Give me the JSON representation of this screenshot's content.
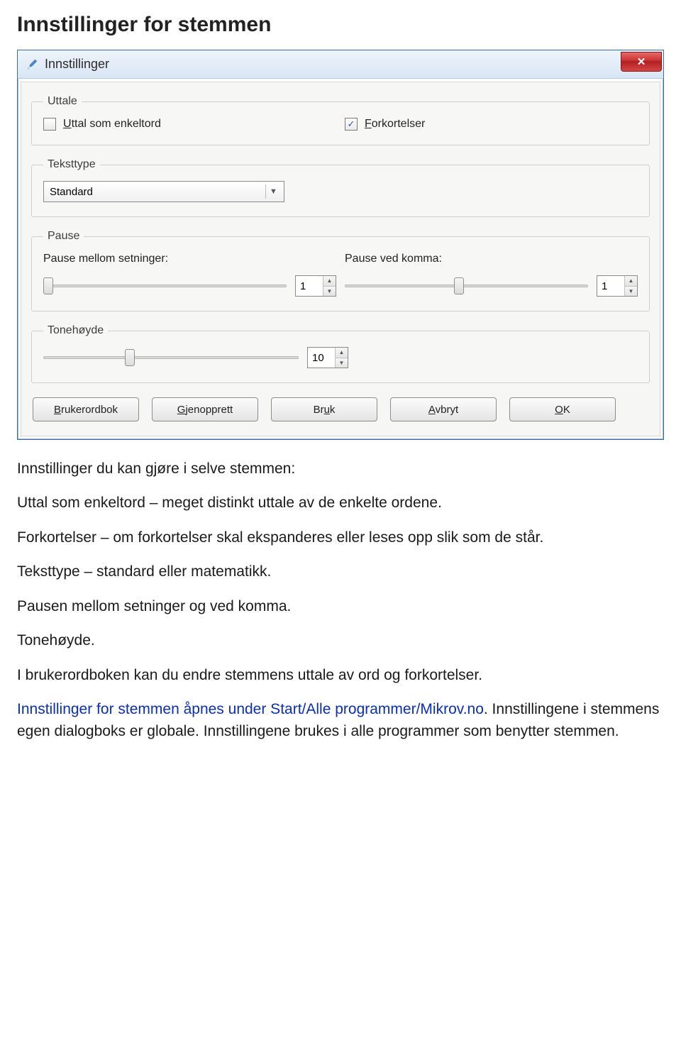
{
  "page_heading": "Innstillinger for stemmen",
  "window": {
    "title": "Innstillinger",
    "close_glyph": "✕"
  },
  "uttale": {
    "legend": "Uttale",
    "checkbox1": {
      "label_pre": "",
      "mn": "U",
      "label_post": "ttal som enkeltord",
      "checked": false
    },
    "checkbox2": {
      "label_pre": "",
      "mn": "F",
      "label_post": "orkortelser",
      "checked": true
    },
    "check_glyph": "✓"
  },
  "teksttype": {
    "legend": "Teksttype",
    "value": "Standard"
  },
  "pause": {
    "legend": "Pause",
    "left_label": "Pause mellom setninger:",
    "left_value": "1",
    "right_label": "Pause ved komma:",
    "right_value": "1"
  },
  "tonehoyde": {
    "legend": "Tonehøyde",
    "value": "10"
  },
  "buttons": {
    "b1_pre": "",
    "b1_mn": "B",
    "b1_post": "rukerordbok",
    "b2_pre": "",
    "b2_mn": "G",
    "b2_post": "jenopprett",
    "b3_pre": "Br",
    "b3_mn": "u",
    "b3_post": "k",
    "b4_pre": "",
    "b4_mn": "A",
    "b4_post": "vbryt",
    "b5_pre": "",
    "b5_mn": "O",
    "b5_post": "K"
  },
  "body": {
    "p1": "Innstillinger du kan gjøre i selve stemmen:",
    "p2": "Uttal som enkeltord – meget distinkt uttale av de enkelte ordene.",
    "p3": "Forkortelser – om forkortelser skal ekspanderes eller leses opp slik som de står.",
    "p4": "Teksttype – standard eller matematikk.",
    "p5": "Pausen mellom setninger og ved komma.",
    "p6": "Tonehøyde.",
    "p7": "I brukerordboken kan du endre stemmens uttale av ord og forkortelser.",
    "p8a": "Innstillinger for stemmen åpnes under Start/Alle programmer/Mikrov.no",
    "p8b": ". Innstillingene i stemmens egen dialogboks er globale. Innstillingene brukes i alle programmer som benytter stemmen."
  }
}
